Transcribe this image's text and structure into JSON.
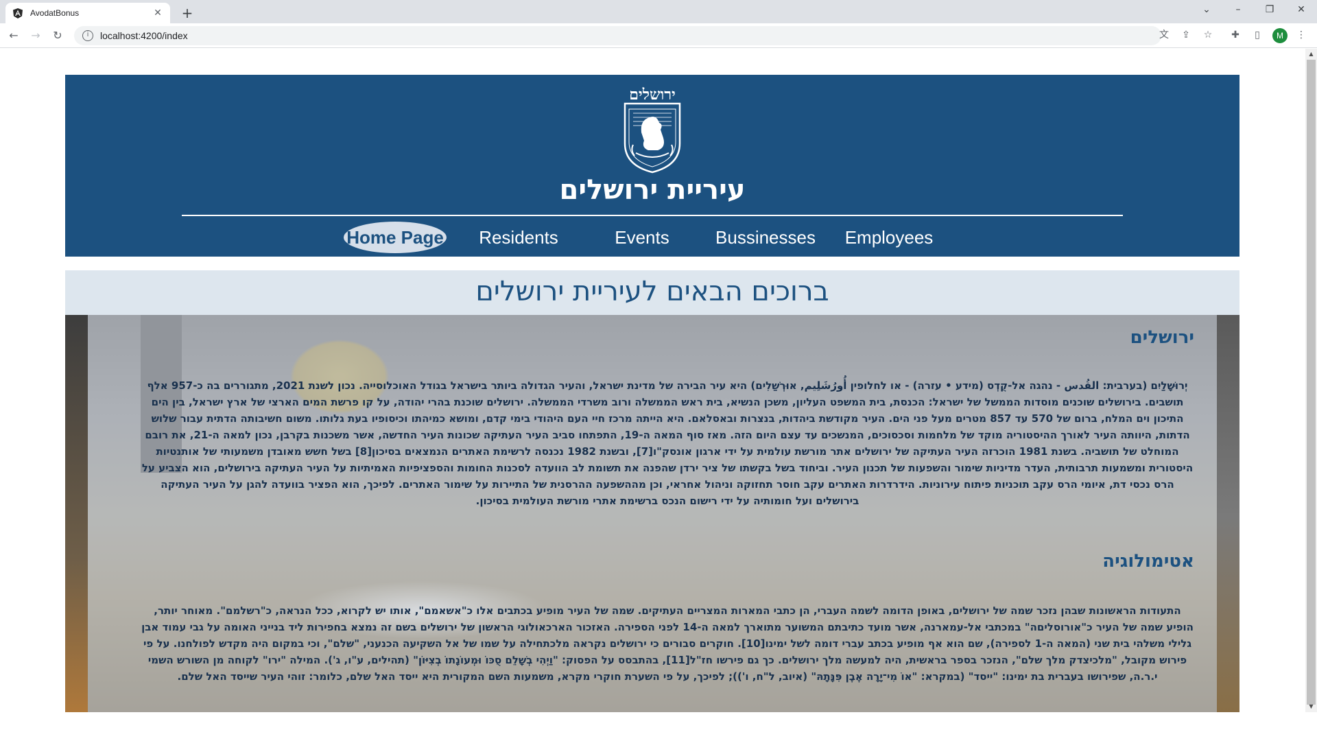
{
  "browser": {
    "tab_title": "AvodatBonus",
    "url": "localhost:4200/index",
    "avatar_letter": "M"
  },
  "header": {
    "emblem_caption": "ירושלים",
    "title": "עיריית ירושלים",
    "nav": [
      {
        "label": "Home Page",
        "active": true
      },
      {
        "label": "Residents"
      },
      {
        "label": "Events"
      },
      {
        "label": "Bussinesses"
      },
      {
        "label": "Employees"
      }
    ]
  },
  "welcome": "ברוכים הבאים לעיריית ירושלים",
  "sections": [
    {
      "title": "ירושלים",
      "text": "יְרוּשָׁלַיִם (בערבית: القُدس - נהגה אל-קֻדְס (מידע • עזרה) - או לחלופין أُورُشَلِيم, אוּרְשַׁלִים) היא עיר הבירה של מדינת ישראל, והעיר הגדולה ביותר בישראל בגודל האוכלוסייה. נכון לשנת 2021, מתגוררים בה כ-957 אלף תושבים. בירושלים שוכנים מוסדות הממשל של ישראל: הכנסת, בית המשפט העליון, משכן הנשיא, בית ראש הממשלה ורוב משרדי הממשלה. ירושלים שוכנת בהרי יהודה, על קו פרשת המים הארצי של ארץ ישראל, בין הים התיכון וים המלח, ברום של 570 עד 857 מטרים מעל פני הים. העיר מקודשת ביהדות, בנצרות ובאסלאם. היא הייתה מרכז חיי העם היהודי בימי קדם, ומושא כמיהתו וכיסופיו בעת גלותו. משום חשיבותה הדתית עבור שלוש הדתות, היוותה העיר לאורך ההיסטוריה מוקד של מלחמות וסכסוכים, המנשכים עד עצם היום הזה. מאז סוף המאה ה-19, התפתחו סביב העיר העתיקה שכונות העיר החדשה, אשר משכנות בקרבן, נכון למאה ה-21, את רובם המוחלט של תושביה. בשנת 1981 הוכרזה העיר העתיקה של ירושלים אתר מורשת עולמית על ידי ארגון אונסק\"ו[7], ובשנת 1982 נכנסה לרשימת האתרים הנמצאים בסיכון[8] בשל חשש מאובדן משמעותי של אותנטיות היסטורית ומשמעות תרבותית, העדר מדיניות שימור והשפעות של תכנון העיר. וביחוד בשל בקשתו של ציר ירדן שהפנה את תשומת לב הוועדה לסכנות החומות והספציפיות האמיתיות על העיר העתיקה בירושלים, הוא הצביע על הרס נכסי דת, איומי הרס עקב תוכניות פיתוח עירוניות. הידרדרות האתרים עקב חוסר תחזוקה וניהול אחראי, וכן מההשפעה ההרסנית של התיירות על שימור האתרים. לפיכך, הוא הפציר בוועדה להגן על העיר העתיקה בירושלים ועל חומותיה על ידי רישום הנכס ברשימת אתרי מורשת העולמית בסיכון."
    },
    {
      "title": "אטימולוגיה",
      "text": "התעודות הראשונות שבהן נזכר שמה של ירושלים, באופן הדומה לשמה העברי, הן כתבי המארות המצריים העתיקים. שמה של העיר מופיע בכתבים אלו כ\"אשאמם\", אותו יש לקרוא, ככל הנראה, כ\"רשלמם\". מאוחר יותר, הופיע שמה של העיר כ\"אורוסליםה\" במכתבי אל-עמארנה, אשר מועד כתיבתם המשוער מתוארך למאה ה-14 לפני הספירה. האזכור הארכאולוגי הראשון של ירושלים בשם זה נמצא בחפירות ליד בנייני האומה על גבי עמוד אבן גלילי משלהי בית שני (המאה ה-1 לספירה), שם הוא אף מופיע בכתב עברי דומה לשל ימינו[10]. חוקרים סבורים כי ירושלים נקראה מלכתחילה על שמו של אל השקיעה הכנעני, \"שלם\", וכי במקום היה מקדש לפולחנו. על פי פירוש מקובל, \"מלכיצדק מלך שלם\", הנזכר בספר בראשית, היה למעשה מלך ירושלים. כך גם פירשו חז\"ל[11], בהתבסס על הפסוק: \"וַיְהִי בְשָׁלֵם סֻכּוֹ וּמְעוֹנָתוֹ בְצִיּוֹן\" (תהילים, ע\"ו, ג'). המילה \"ירו\" לקוחה מן השורש השמי י.ר.ה, שפירושו בעברית בת ימינו: \"ייסד\" (במקרא: \"אוֹ מִי־יָרָה אֶבֶן פִּנָּתָהּ\" (איוב, ל\"ח, ו')); לפיכך, על פי השערת חוקרי מקרא, משמעות השם המקורית היא ייסד האל שלם, כלומר: זוהי העיר שייסד האל שלם."
    }
  ],
  "colors": {
    "header_bg": "#1c5180",
    "welcome_bg": "#dde6ee",
    "text": "#18304d"
  }
}
